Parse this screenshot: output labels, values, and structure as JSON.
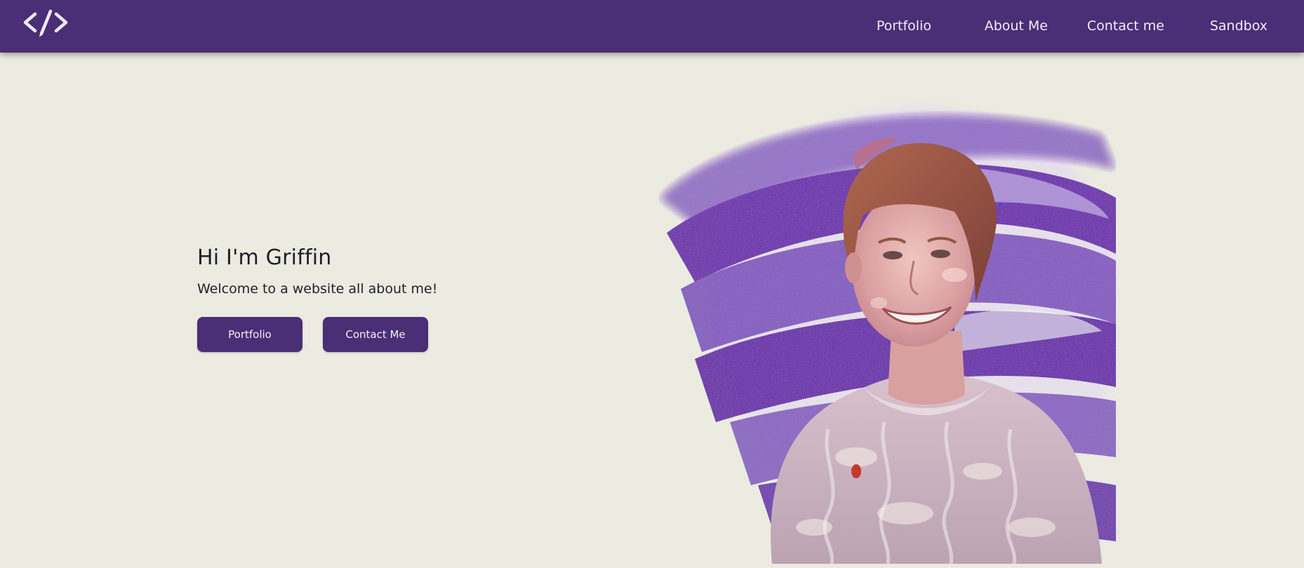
{
  "nav": {
    "logo_icon": "code-pen-icon",
    "links": [
      {
        "label": "Portfolio"
      },
      {
        "label": "About Me"
      },
      {
        "label": "Contact me"
      },
      {
        "label": "Sandbox"
      }
    ]
  },
  "hero": {
    "title": "Hi I'm Griffin",
    "subtitle": "Welcome to a website all about me!",
    "buttons": {
      "portfolio": "Portfolio",
      "contact": "Contact Me"
    }
  },
  "photo": {
    "alt": "Portrait of Griffin smiling in a cream cable-knit sweater over a purple brush-stroke background"
  },
  "colors": {
    "brand": "#4a2e76",
    "background": "#ebebe1",
    "text": "#1f1f2a",
    "accent_stroke": "#7a5ab0"
  }
}
